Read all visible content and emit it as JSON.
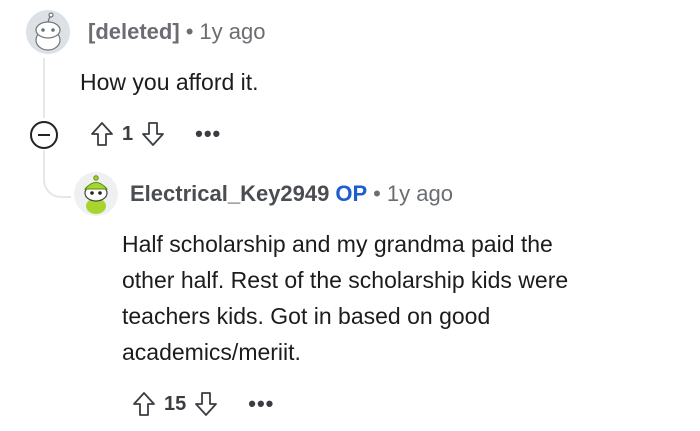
{
  "comment1": {
    "author": "[deleted]",
    "separator": "•",
    "time": "1y ago",
    "body": "How you afford it.",
    "score": "1",
    "more_label": "•••"
  },
  "comment2": {
    "author": "Electrical_Key2949",
    "op_badge": "OP",
    "separator": "•",
    "time": "1y ago",
    "body_lines": [
      "Half scholarship and my grandma paid the",
      "other half. Rest of the scholarship kids were",
      "teachers kids. Got in based on good",
      "academics/meriit."
    ],
    "score": "15",
    "more_label": "•••"
  },
  "icons": {
    "upvote": "upvote-arrow-icon",
    "downvote": "downvote-arrow-icon",
    "collapse": "collapse-minus-icon"
  },
  "colors": {
    "op": "#1d5ecf",
    "thread_line": "#e5e8ea",
    "avatar2_green": "#9fd12a"
  }
}
